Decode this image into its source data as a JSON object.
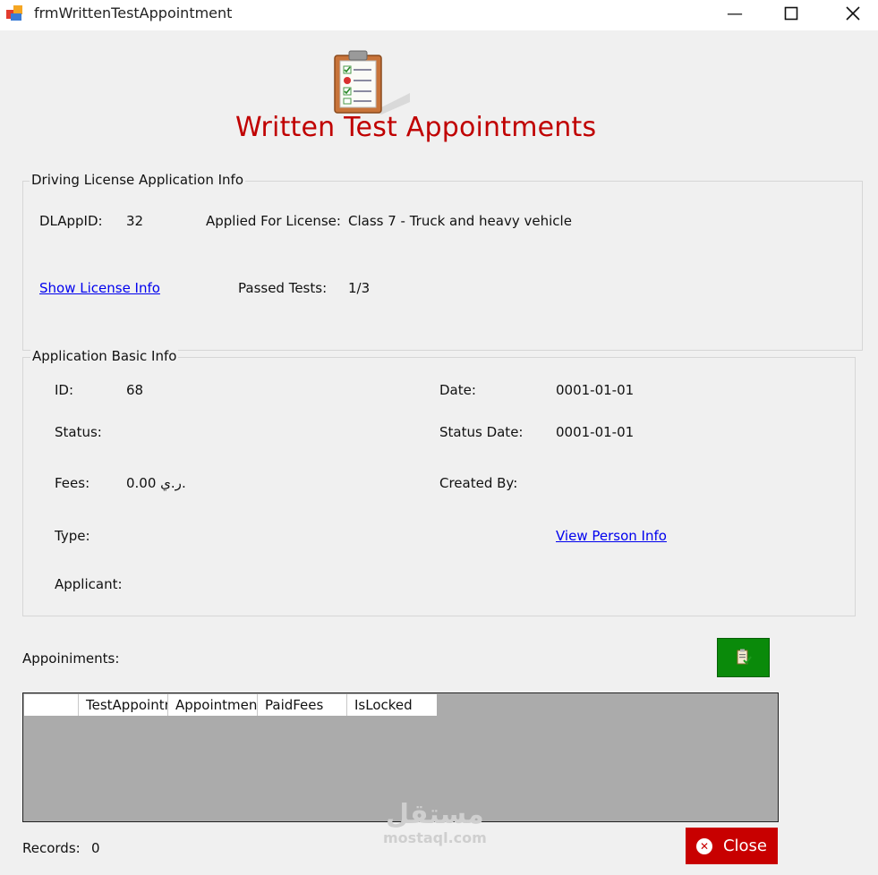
{
  "window": {
    "title": "frmWrittenTestAppointment",
    "min_glyph": "—",
    "max_glyph": "☐",
    "close_glyph": "✕"
  },
  "header": {
    "title": "Written Test Appointments",
    "icon": "clipboard-checklist-icon"
  },
  "license_info": {
    "legend": "Driving License Application Info",
    "dlappid_label": "DLAppID:",
    "dlappid_value": "32",
    "applied_label": "Applied For License:",
    "applied_value": "Class 7 - Truck and heavy vehicle",
    "show_link": "Show License Info",
    "passed_label": "Passed Tests:",
    "passed_value": "1/3"
  },
  "basic_info": {
    "legend": "Application Basic Info",
    "id_label": "ID:",
    "id_value": "68",
    "date_label": "Date:",
    "date_value": "0001-01-01",
    "status_label": "Status:",
    "status_value": "",
    "status_date_label": "Status Date:",
    "status_date_value": "0001-01-01",
    "fees_label": "Fees:",
    "fees_value": "0.00 ر.ي.",
    "created_by_label": "Created By:",
    "created_by_value": "",
    "type_label": "Type:",
    "type_value": "",
    "view_person_link": "View Person Info",
    "applicant_label": "Applicant:",
    "applicant_value": ""
  },
  "appointments": {
    "label": "Appoiniments:",
    "add_button_icon": "add-appointment-icon",
    "columns": [
      "",
      "TestAppointmentID",
      "AppointmentDate",
      "PaidFees",
      "IsLocked"
    ],
    "rows": []
  },
  "footer": {
    "records_label": "Records:",
    "records_value": "0",
    "close_label": "Close"
  },
  "watermark": {
    "arabic": "مستقل",
    "english": "mostaql.com"
  },
  "colors": {
    "heading": "#c00000",
    "close_button": "#c80000",
    "add_button": "#0a8a0a",
    "grid_background": "#ababab",
    "link": "#0000ee"
  }
}
